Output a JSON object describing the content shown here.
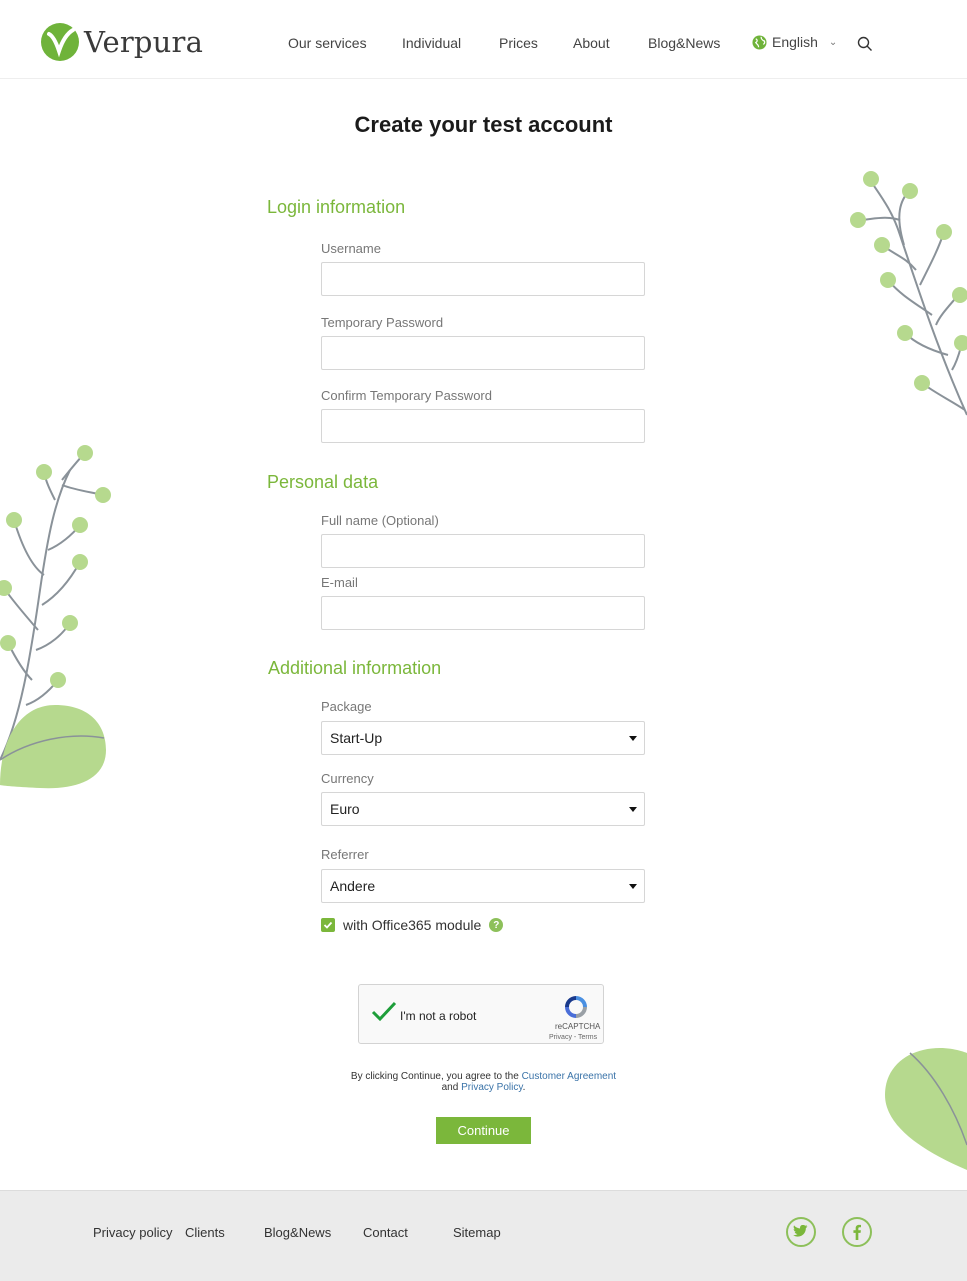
{
  "brand": {
    "name": "Verpura",
    "accent": "#7bb73b"
  },
  "nav": {
    "items": [
      "Our services",
      "Individual",
      "Prices",
      "About",
      "Blog&News"
    ],
    "language": "English"
  },
  "page": {
    "title": "Create your test account"
  },
  "sections": {
    "login": "Login information",
    "personal": "Personal data",
    "additional": "Additional information"
  },
  "fields": {
    "username": {
      "label": "Username",
      "value": ""
    },
    "temp_password": {
      "label": "Temporary Password",
      "value": ""
    },
    "confirm_password": {
      "label": "Confirm Temporary Password",
      "value": ""
    },
    "full_name": {
      "label": "Full name (Optional)",
      "value": ""
    },
    "email": {
      "label": "E-mail",
      "value": ""
    },
    "package": {
      "label": "Package",
      "value": "Start-Up"
    },
    "currency": {
      "label": "Currency",
      "value": "Euro"
    },
    "referrer": {
      "label": "Referrer",
      "value": "Andere"
    }
  },
  "office365": {
    "label": "with Office365 module",
    "checked": true
  },
  "recaptcha": {
    "label": "I'm not a robot",
    "brand": "reCAPTCHA",
    "links": "Privacy - Terms"
  },
  "agreement": {
    "prefix": "By clicking Continue, you agree to the",
    "customer_agreement": "Customer Agreement",
    "and": "and",
    "privacy_policy": "Privacy Policy",
    "suffix": "."
  },
  "continue_label": "Continue",
  "footer": {
    "links": [
      "Privacy policy",
      "Clients",
      "Blog&News",
      "Contact",
      "Sitemap"
    ],
    "social": [
      "twitter-icon",
      "facebook-icon"
    ]
  }
}
